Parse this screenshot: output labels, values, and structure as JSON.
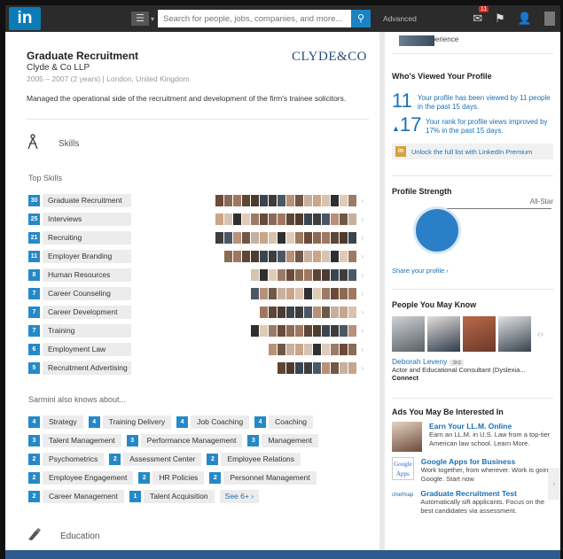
{
  "topbar": {
    "logo": "in",
    "search_placeholder": "Search for people, jobs, companies, and more...",
    "advanced": "Advanced",
    "messages_count": "11"
  },
  "job": {
    "title": "Graduate Recruitment",
    "company": "Clyde & Co LLP",
    "meta": "2005 – 2007 (2 years)  |  London, United Kingdom",
    "description": "Managed the operational side of the recruitment and development of the firm's trainee solicitors.",
    "logo_text": "CLYDE&CO"
  },
  "skills_section": {
    "title": "Skills",
    "top_skills_label": "Top Skills",
    "skills": [
      {
        "count": "30",
        "name": "Graduate Recruitment",
        "endorsers": 16
      },
      {
        "count": "25",
        "name": "Interviews",
        "endorsers": 16
      },
      {
        "count": "21",
        "name": "Recruiting",
        "endorsers": 16
      },
      {
        "count": "11",
        "name": "Employer Branding",
        "endorsers": 15
      },
      {
        "count": "8",
        "name": "Human Resources",
        "endorsers": 12
      },
      {
        "count": "7",
        "name": "Career Counseling",
        "endorsers": 12
      },
      {
        "count": "7",
        "name": "Career Development",
        "endorsers": 11
      },
      {
        "count": "7",
        "name": "Training",
        "endorsers": 12
      },
      {
        "count": "6",
        "name": "Employment Law",
        "endorsers": 10
      },
      {
        "count": "5",
        "name": "Recruitment Advertising",
        "endorsers": 9
      }
    ],
    "also_knows_label": "Sarmini also knows about...",
    "also_knows": [
      [
        {
          "count": "4",
          "name": "Strategy"
        },
        {
          "count": "4",
          "name": "Training Delivery"
        },
        {
          "count": "4",
          "name": "Job Coaching"
        },
        {
          "count": "4",
          "name": "Coaching"
        }
      ],
      [
        {
          "count": "3",
          "name": "Talent Management"
        },
        {
          "count": "3",
          "name": "Performance Management"
        },
        {
          "count": "3",
          "name": "Management"
        }
      ],
      [
        {
          "count": "2",
          "name": "Psychometrics"
        },
        {
          "count": "2",
          "name": "Assessment Center"
        },
        {
          "count": "2",
          "name": "Employee Relations"
        }
      ],
      [
        {
          "count": "2",
          "name": "Employee Engagement"
        },
        {
          "count": "2",
          "name": "HR Policies"
        },
        {
          "count": "2",
          "name": "Personnel Management"
        }
      ],
      [
        {
          "count": "2",
          "name": "Career Management"
        },
        {
          "count": "1",
          "name": "Talent Acquisition"
        }
      ]
    ],
    "see_more": "See 6+ ›"
  },
  "education": {
    "title": "Education"
  },
  "right": {
    "experience_text": "experience",
    "whos_viewed": {
      "title": "Who's Viewed Your Profile",
      "views_num": "11",
      "views_text": "Your profile has been viewed by 11 people in the past 15 days.",
      "rank_num": "17",
      "rank_text": "Your rank for profile views improved by 17% in the past 15 days.",
      "premium": "Unlock the full list with LinkedIn Premium"
    },
    "strength": {
      "title": "Profile Strength",
      "level": "All-Star",
      "share": "Share your profile ›"
    },
    "pymk": {
      "title": "People You May Know",
      "name": "Deborah Leveny",
      "degree": "3rd",
      "desc": "Actor and Educational Consultant (Dyslexia...",
      "connect": "Connect"
    },
    "ads": {
      "title": "Ads You May Be Interested In",
      "items": [
        {
          "title": "Earn Your LL.M. Online",
          "text": "Earn an LL.M. in U.S. Law from a top-tier American law school. Learn More."
        },
        {
          "title": "Google Apps for Business",
          "text": "Work together, from wherever. Work is going Google. Start now",
          "logo": "Google Apps"
        },
        {
          "title": "Graduate Recruitment Test",
          "text": "Automatically sift applicants. Focus on the best candidates via assessment.",
          "logo": "chiefmap"
        }
      ]
    }
  },
  "colors": {
    "accent": "#2689c7",
    "link": "#1a6fb5",
    "topbar": "#2b2b2b"
  }
}
